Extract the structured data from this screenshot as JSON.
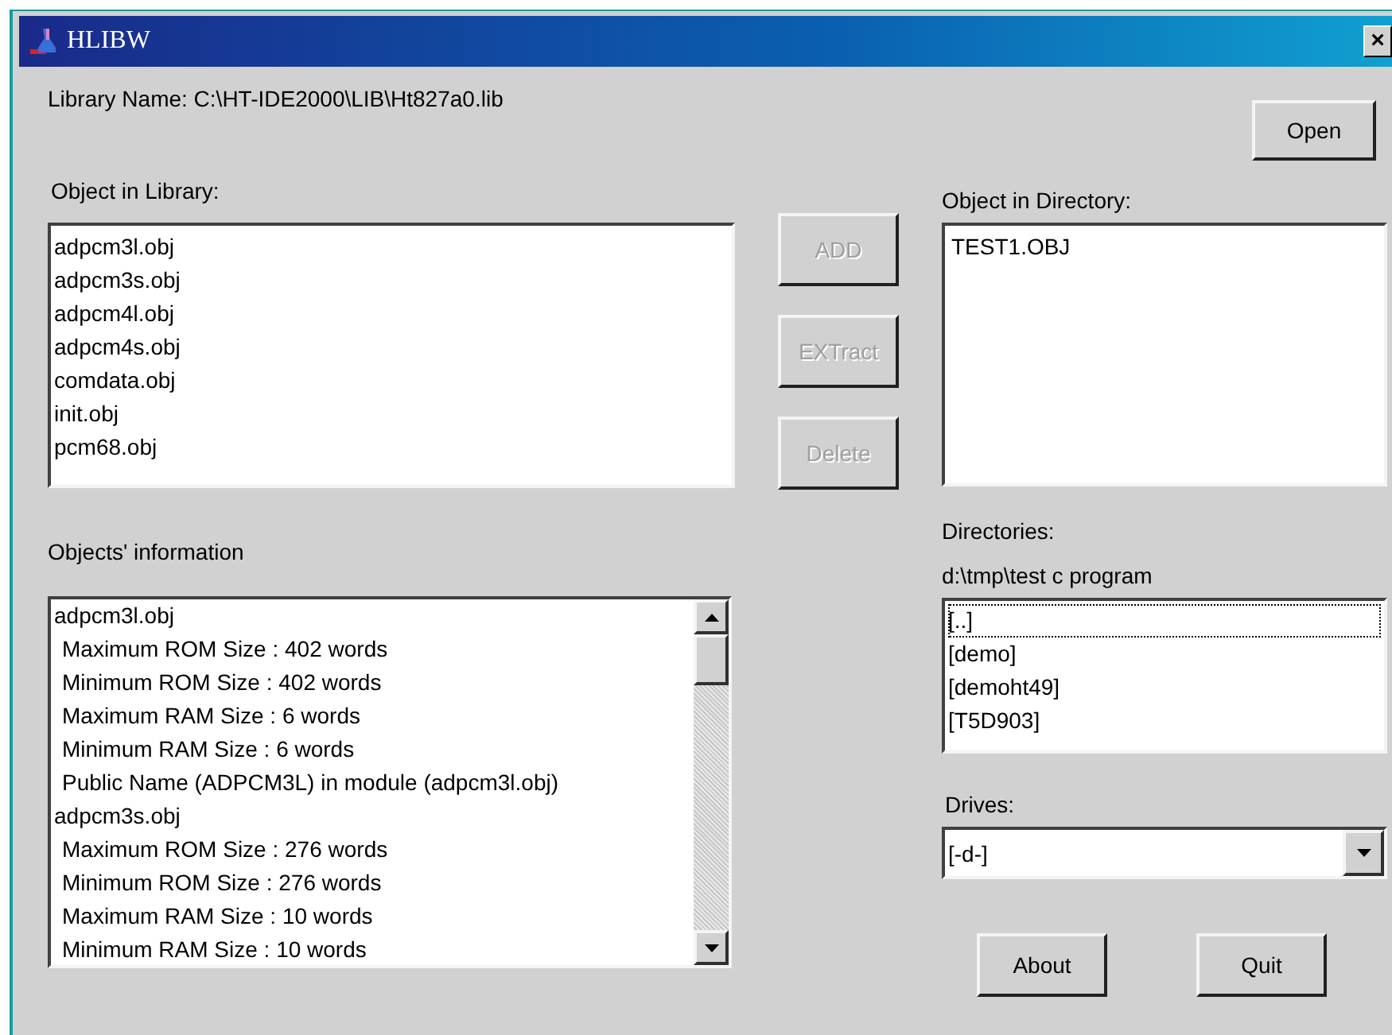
{
  "window": {
    "title": "HLIBW",
    "close": "×"
  },
  "library_name": "Library Name: C:\\HT-IDE2000\\LIB\\Ht827a0.lib",
  "open_button": {
    "label": "Open",
    "disabled": false
  },
  "library_objects": {
    "label": "Object in Library:",
    "items": [
      "adpcm3l.obj",
      "adpcm3s.obj",
      "adpcm4l.obj",
      "adpcm4s.obj",
      "comdata.obj",
      "init.obj",
      "pcm68.obj"
    ]
  },
  "action_buttons": [
    {
      "label": "ADD",
      "disabled": true
    },
    {
      "label": "EXTract",
      "disabled": true
    },
    {
      "label": "Delete",
      "disabled": true
    }
  ],
  "directory_objects": {
    "label": "Object in Directory:",
    "items": [
      "TEST1.OBJ"
    ]
  },
  "objects_info": {
    "label": "Objects' information",
    "lines": [
      {
        "kind": "file",
        "text": "adpcm3l.obj"
      },
      {
        "kind": "detail",
        "text": "Maximum ROM Size : 402 words"
      },
      {
        "kind": "detail",
        "text": "Minimum ROM Size : 402 words"
      },
      {
        "kind": "detail",
        "text": "Maximum RAM Size : 6 words"
      },
      {
        "kind": "detail",
        "text": "Minimum RAM Size : 6 words"
      },
      {
        "kind": "detail",
        "text": "Public Name (ADPCM3L) in module (adpcm3l.obj)"
      },
      {
        "kind": "file",
        "text": "adpcm3s.obj"
      },
      {
        "kind": "detail",
        "text": "Maximum ROM Size : 276 words"
      },
      {
        "kind": "detail",
        "text": "Minimum ROM Size : 276 words"
      },
      {
        "kind": "detail",
        "text": "Maximum RAM Size : 10 words"
      },
      {
        "kind": "detail",
        "text": "Minimum RAM Size : 10 words"
      }
    ]
  },
  "directories": {
    "label": "Directories:",
    "path": "d:\\tmp\\test c program",
    "items": [
      {
        "text": "[..]",
        "selected": true
      },
      {
        "text": "[demo]",
        "selected": false
      },
      {
        "text": "[demoht49]",
        "selected": false
      },
      {
        "text": "[T5D903]",
        "selected": false
      }
    ]
  },
  "drives": {
    "label": "Drives:",
    "value": "[-d-]"
  },
  "bottom_buttons": [
    {
      "label": "About",
      "disabled": false
    },
    {
      "label": "Quit",
      "disabled": false
    }
  ]
}
